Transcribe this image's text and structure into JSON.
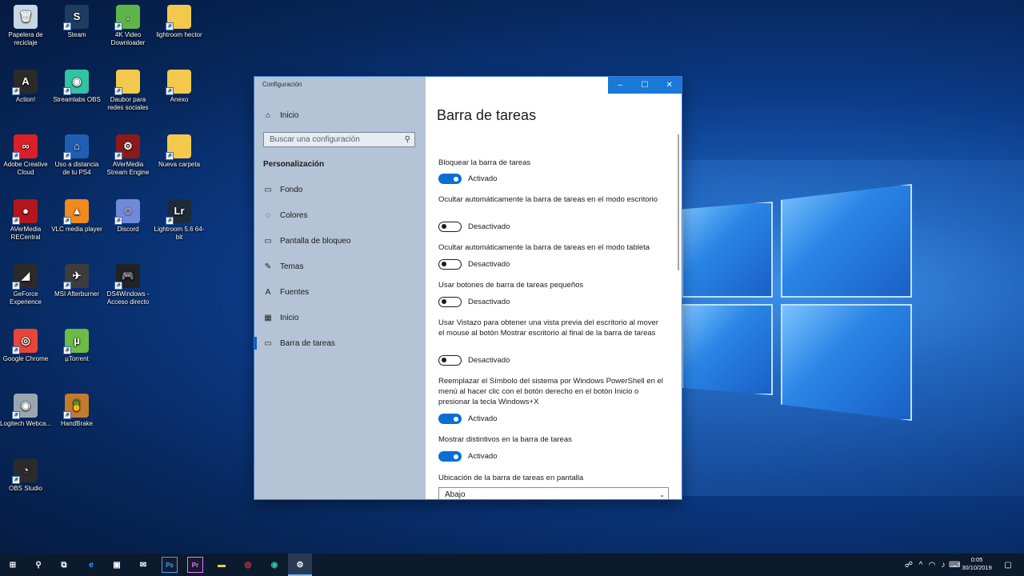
{
  "desktop_icons": [
    {
      "label": "Papelera de reciclaje",
      "icon": "recycle-bin-icon",
      "color": "#c9d6e4",
      "glyph": "🗑"
    },
    {
      "label": "Steam",
      "icon": "steam-icon",
      "color": "#1f3d5f",
      "glyph": "S"
    },
    {
      "label": "4K Video Downloader",
      "icon": "4k-downloader-icon",
      "color": "#5fb548",
      "glyph": "↓"
    },
    {
      "label": "lightroom hector",
      "icon": "folder-icon",
      "color": "#f2c94c",
      "glyph": ""
    },
    {
      "label": "Action!",
      "icon": "action-icon",
      "color": "#2b2b2b",
      "glyph": "A"
    },
    {
      "label": "Streamlabs OBS",
      "icon": "streamlabs-icon",
      "color": "#31c3a2",
      "glyph": "◉"
    },
    {
      "label": "Daubor para redes sociales",
      "icon": "folder-icon",
      "color": "#f2c94c",
      "glyph": ""
    },
    {
      "label": "Anexo",
      "icon": "folder-icon",
      "color": "#f2c94c",
      "glyph": ""
    },
    {
      "label": "Adobe Creative Cloud",
      "icon": "creative-cloud-icon",
      "color": "#da1f26",
      "glyph": "∞"
    },
    {
      "label": "Uso a distancia de tu PS4",
      "icon": "ps4-remote-icon",
      "color": "#1f5fb3",
      "glyph": "⌂"
    },
    {
      "label": "AVerMedia Stream Engine",
      "icon": "avermedia-engine-icon",
      "color": "#8c1a1a",
      "glyph": "⚙"
    },
    {
      "label": "Nueva carpeta",
      "icon": "folder-icon",
      "color": "#f2c94c",
      "glyph": ""
    },
    {
      "label": "AVerMedia RECentral",
      "icon": "avermedia-recentral-icon",
      "color": "#b3161c",
      "glyph": "●"
    },
    {
      "label": "VLC media player",
      "icon": "vlc-icon",
      "color": "#f28a1e",
      "glyph": "▲"
    },
    {
      "label": "Discord",
      "icon": "discord-icon",
      "color": "#7289da",
      "glyph": "☺"
    },
    {
      "label": "Lightroom 5.6 64-bit",
      "icon": "lightroom-icon",
      "color": "#1e2a38",
      "glyph": "Lr"
    },
    {
      "label": "GeForce Experience",
      "icon": "geforce-icon",
      "color": "#2b2b2b",
      "glyph": "◢"
    },
    {
      "label": "MSI Afterburner",
      "icon": "msi-afterburner-icon",
      "color": "#3d3d3d",
      "glyph": "✈"
    },
    {
      "label": "DS4Windows - Acceso directo",
      "icon": "ds4windows-icon",
      "color": "#222222",
      "glyph": "🎮"
    },
    {
      "label": "Google Chrome",
      "icon": "chrome-icon",
      "color": "#e8453c",
      "glyph": "◎"
    },
    {
      "label": "µTorrent",
      "icon": "utorrent-icon",
      "color": "#6dbb45",
      "glyph": "µ"
    },
    {
      "label": "Logitech Webca...",
      "icon": "logitech-webcam-icon",
      "color": "#9aa7b3",
      "glyph": "◉"
    },
    {
      "label": "HandBrake",
      "icon": "handbrake-icon",
      "color": "#c27b2d",
      "glyph": "🍍"
    },
    {
      "label": "OBS Studio",
      "icon": "obs-icon",
      "color": "#2b2b2b",
      "glyph": "◔"
    }
  ],
  "window": {
    "title": "Configuración",
    "caption_min": "–",
    "caption_max": "☐",
    "caption_close": "✕",
    "home_label": "Inicio",
    "search_placeholder": "Buscar una configuración",
    "section_heading": "Personalización",
    "nav_items": [
      {
        "label": "Fondo",
        "icon": "picture-icon",
        "glyph": "▭"
      },
      {
        "label": "Colores",
        "icon": "palette-icon",
        "glyph": "◌"
      },
      {
        "label": "Pantalla de bloqueo",
        "icon": "lock-screen-icon",
        "glyph": "▭"
      },
      {
        "label": "Temas",
        "icon": "brush-icon",
        "glyph": "✎"
      },
      {
        "label": "Fuentes",
        "icon": "font-icon",
        "glyph": "A"
      },
      {
        "label": "Inicio",
        "icon": "start-icon",
        "glyph": "▦"
      },
      {
        "label": "Barra de tareas",
        "icon": "taskbar-icon",
        "glyph": "▭"
      }
    ],
    "page_title": "Barra de tareas",
    "settings": [
      {
        "label": "Bloquear la barra de tareas",
        "state": "Activado",
        "on": true
      },
      {
        "label": "Ocultar automáticamente la barra de tareas en el modo escritorio",
        "state": "Desactivado",
        "on": false
      },
      {
        "label": "Ocultar automáticamente la barra de tareas en el modo tableta",
        "state": "Desactivado",
        "on": false
      },
      {
        "label": "Usar botones de barra de tareas pequeños",
        "state": "Desactivado",
        "on": false
      },
      {
        "label": "Usar Vistazo para obtener una vista previa del escritorio al mover el mouse al botón Mostrar escritorio al final de la barra de tareas",
        "state": "Desactivado",
        "on": false
      },
      {
        "label": "Reemplazar el Símbolo del sistema por Windows PowerShell en el menú al hacer clic con el botón derecho en el botón Inicio o presionar la tecla Windows+X",
        "state": "Activado",
        "on": true
      },
      {
        "label": "Mostrar distintivos en la barra de tareas",
        "state": "Activado",
        "on": true
      }
    ],
    "location_label": "Ubicación de la barra de tareas en pantalla",
    "location_value": "Abajo"
  },
  "taskbar": {
    "apps": [
      {
        "name": "start-button",
        "glyph": "⊞"
      },
      {
        "name": "search-icon",
        "glyph": "⚲"
      },
      {
        "name": "task-view-icon",
        "glyph": "⧉"
      },
      {
        "name": "edge-icon",
        "glyph": "e"
      },
      {
        "name": "store-icon",
        "glyph": "▣"
      },
      {
        "name": "mail-icon",
        "glyph": "✉"
      },
      {
        "name": "photoshop-icon",
        "glyph": "Ps"
      },
      {
        "name": "premiere-icon",
        "glyph": "Pr"
      },
      {
        "name": "file-explorer-icon",
        "glyph": "▬"
      },
      {
        "name": "chrome-icon",
        "glyph": "◎"
      },
      {
        "name": "streamlabs-icon",
        "glyph": "◉"
      },
      {
        "name": "settings-icon",
        "glyph": "⚙"
      }
    ],
    "time": "0:05",
    "date": "30/10/2019"
  }
}
